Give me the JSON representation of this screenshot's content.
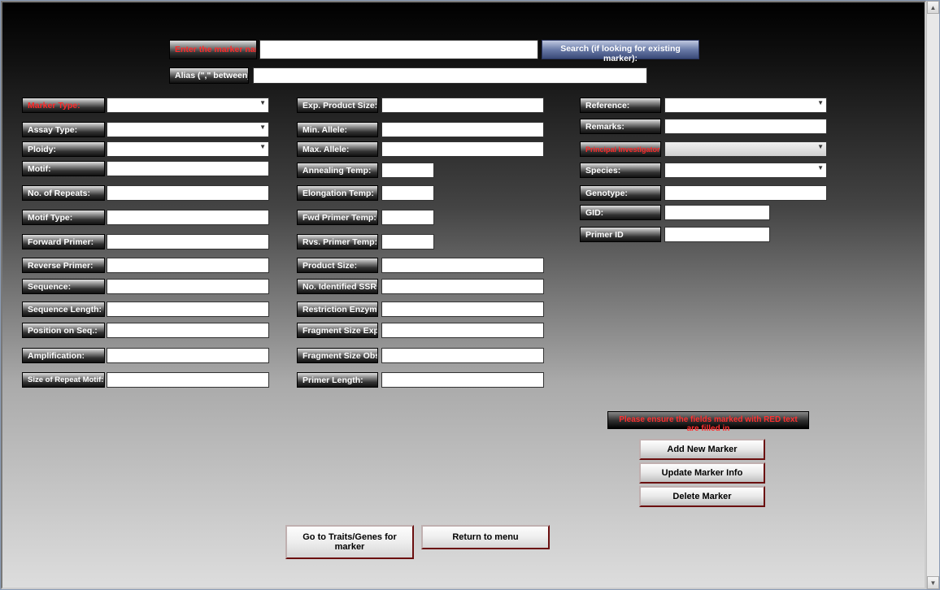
{
  "top": {
    "marker_name_lbl": "Enter the marker name",
    "search_btn": "Search (if looking for existing marker):",
    "alias_lbl": "Alias (\",\" between):"
  },
  "col1": {
    "marker_type": "Marker Type:",
    "assay_type": "Assay Type:",
    "ploidy": "Ploidy:",
    "motif": "Motif:",
    "no_repeats": "No. of Repeats:",
    "motif_type": "Motif Type:",
    "fwd_primer": "Forward Primer:",
    "rev_primer": "Reverse Primer:",
    "sequence": "Sequence:",
    "seq_len": "Sequence Length:",
    "pos_seq": "Position on Seq.:",
    "amplification": "Amplification:",
    "size_repeat_motif": "Size of Repeat Motif:"
  },
  "col2": {
    "exp_product_size": "Exp. Product Size:",
    "min_allele": "Min. Allele:",
    "max_allele": "Max. Allele:",
    "annealing_temp": "Annealing Temp:",
    "elongation_temp": "Elongation Temp:",
    "fwd_primer_temp": "Fwd Primer Temp:",
    "rvs_primer_temp": "Rvs. Primer Temp:",
    "product_size": "Product Size:",
    "no_ssrs": "No. Identified SSRs:",
    "restriction_enzyme": "Restriction Enzyme:",
    "frag_size_exp": "Fragment Size Exp:",
    "frag_size_obs": "Fragment Size Obs:",
    "primer_length": "Primer Length:"
  },
  "col3": {
    "reference": "Reference:",
    "remarks": "Remarks:",
    "pi": "Principal Investigator:",
    "species": "Species:",
    "genotype": "Genotype:",
    "gid": "GID:",
    "primer_id": "Primer ID"
  },
  "notice": "Please ensure the fields marked with RED text are filled in",
  "actions": {
    "add": "Add New Marker",
    "update": "Update Marker Info",
    "delete": "Delete Marker"
  },
  "nav": {
    "traits": "Go to Traits/Genes for marker",
    "return": "Return to menu"
  }
}
